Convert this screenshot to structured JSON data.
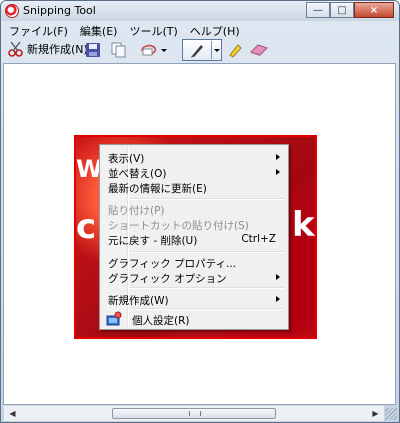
{
  "window": {
    "title": "Snipping Tool",
    "buttons": {
      "minimize": "—",
      "maximize": "□",
      "close": "×"
    }
  },
  "menubar": [
    {
      "label": "ファイル(F)"
    },
    {
      "label": "編集(E)"
    },
    {
      "label": "ツール(T)"
    },
    {
      "label": "ヘルプ(H)"
    }
  ],
  "toolbar": {
    "new_label": "新規作成(N)",
    "icons": [
      "scissors-icon",
      "save-icon",
      "copy-icon",
      "send-icon",
      "pen-icon",
      "highlighter-icon",
      "eraser-icon"
    ]
  },
  "snip_text": {
    "left_fragment": "W",
    "c_fragment": "c",
    "k_fragment": "k"
  },
  "context_menu": {
    "items": [
      {
        "label": "表示(V)",
        "submenu": true,
        "disabled": false
      },
      {
        "label": "並べ替え(O)",
        "submenu": true,
        "disabled": false
      },
      {
        "label": "最新の情報に更新(E)",
        "submenu": false,
        "disabled": false
      },
      {
        "label": "貼り付け(P)",
        "submenu": false,
        "disabled": true
      },
      {
        "label": "ショートカットの貼り付け(S)",
        "submenu": false,
        "disabled": true
      },
      {
        "label": "元に戻す - 削除(U)",
        "shortcut": "Ctrl+Z",
        "submenu": false,
        "disabled": false
      },
      {
        "label": "グラフィック プロパティ...",
        "submenu": false,
        "disabled": false
      },
      {
        "label": "グラフィック オプション",
        "submenu": true,
        "disabled": false
      },
      {
        "label": "新規作成(W)",
        "submenu": true,
        "disabled": false
      },
      {
        "label": "個人設定(R)",
        "submenu": false,
        "disabled": false,
        "icon": "personalize-icon"
      }
    ]
  },
  "colors": {
    "accent": "#e30000",
    "menu_bg": "#f0f0f0",
    "chrome": "#c6d3e2"
  }
}
